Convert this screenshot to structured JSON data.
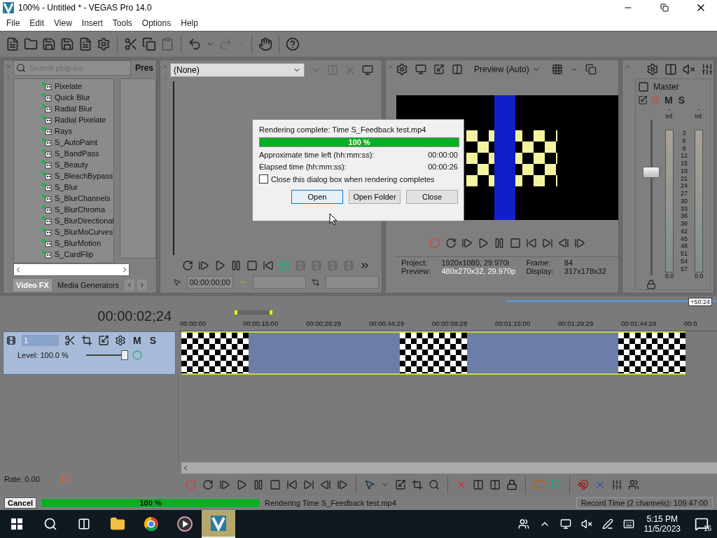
{
  "window": {
    "title": "100% - Untitled * - VEGAS Pro 14.0"
  },
  "menu": [
    "File",
    "Edit",
    "View",
    "Insert",
    "Tools",
    "Options",
    "Help"
  ],
  "plugins": {
    "search_placeholder": "Search plug-ins",
    "presets_heading": "Pres",
    "items": [
      "Pixelate",
      "Quick Blur",
      "Radial Blur",
      "Radial Pixelate",
      "Rays",
      "S_AutoPaint",
      "S_BandPass",
      "S_Beauty",
      "S_BleachBypass",
      "S_Blur",
      "S_BlurChannels",
      "S_BlurChroma",
      "S_BlurDirectional",
      "S_BlurMoCurves",
      "S_BlurMotion",
      "S_CardFlip"
    ],
    "tabs": [
      {
        "label": "Video FX",
        "selected": true
      },
      {
        "label": "Media Generators",
        "selected": false
      }
    ]
  },
  "trimmer": {
    "media": "(None)",
    "timecode": "00:00:00;00"
  },
  "preview": {
    "quality": "Preview (Auto)",
    "info": [
      {
        "label": "Project:",
        "value": "1920x1080, 29.970i"
      },
      {
        "label": "Frame:",
        "value": "84"
      },
      {
        "label": "Preview:",
        "value": "480x270x32, 29.970p"
      },
      {
        "label": "Display:",
        "value": "317x178x32"
      }
    ]
  },
  "mixer": {
    "name": "Master",
    "mute": "M",
    "solo": "S",
    "peaks": [
      "-Inf.",
      "-Inf."
    ],
    "scale": [
      "3",
      "6",
      "9",
      "12",
      "15",
      "18",
      "21",
      "24",
      "27",
      "30",
      "33",
      "36",
      "39",
      "42",
      "45",
      "48",
      "51",
      "54",
      "57"
    ],
    "readouts": [
      "0.0",
      "0.0"
    ],
    "fader": {
      "level": 0.66
    }
  },
  "timeline": {
    "timecode": "00:00:02;24",
    "region_length": "+50:24",
    "ruler": [
      "00:00:00",
      "00:00:15:00",
      "00:00:29:29",
      "00:00:44:29",
      "00:00:59:28",
      "00:01:15:00",
      "00:01:29:29",
      "00:01:44:29",
      "00:0"
    ],
    "track": {
      "number": "1",
      "mute": "M",
      "solo": "S",
      "level_text": "Level: 100.0 %",
      "level": 0.92,
      "selected": true
    },
    "rate": "Rate: 0.00"
  },
  "render_dialog": {
    "title": "Rendering complete: Time S_Feedback test.mp4",
    "progress": {
      "level": 1,
      "text": "100 %"
    },
    "rows": [
      {
        "label": "Approximate time left (hh:mm:ss):",
        "value": "00:00:00"
      },
      {
        "label": "Elapsed time (hh:mm:ss):",
        "value": "00:00:26"
      }
    ],
    "close_when_done": {
      "label": "Close this dialog box when rendering completes",
      "checked": false
    },
    "buttons": [
      {
        "label": "Open",
        "selected": true
      },
      {
        "label": "Open Folder",
        "selected": false
      },
      {
        "label": "Close",
        "selected": false
      }
    ]
  },
  "status_bar": {
    "cancel": "Cancel",
    "progress": {
      "level": 1,
      "text": "100 %"
    },
    "message": "Rendering Time S_Feedback test.mp4",
    "record_time": "Record Time (2 channels): 109:47:00"
  },
  "taskbar": {
    "time": "5:15 PM",
    "date": "11/5/2023",
    "notifications": "16"
  }
}
